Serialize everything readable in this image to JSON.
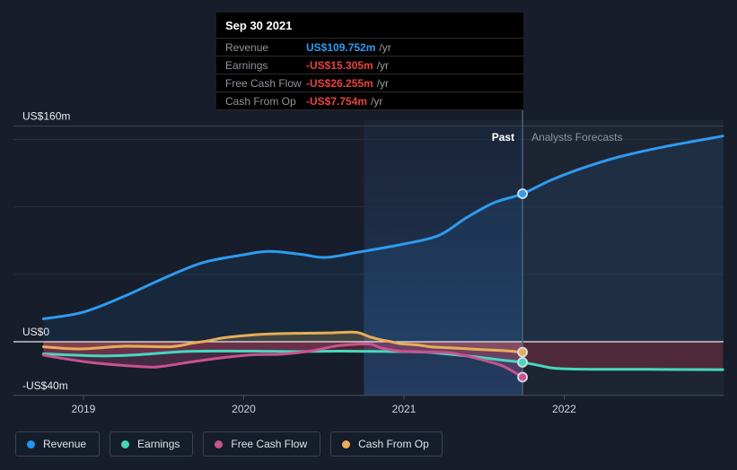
{
  "tooltip": {
    "date": "Sep 30 2021",
    "rows": [
      {
        "label": "Revenue",
        "value": "US$109.752m",
        "suffix": "/yr",
        "color": "#2E9BF0"
      },
      {
        "label": "Earnings",
        "value": "-US$15.305m",
        "suffix": "/yr",
        "color": "#E8443C"
      },
      {
        "label": "Free Cash Flow",
        "value": "-US$26.255m",
        "suffix": "/yr",
        "color": "#E8443C"
      },
      {
        "label": "Cash From Op",
        "value": "-US$7.754m",
        "suffix": "/yr",
        "color": "#E8443C"
      }
    ]
  },
  "labels": {
    "past": "Past",
    "forecast": "Analysts Forecasts"
  },
  "legend": [
    {
      "label": "Revenue",
      "color": "#2196F3"
    },
    {
      "label": "Earnings",
      "color": "#45D6B8"
    },
    {
      "label": "Free Cash Flow",
      "color": "#C9528F"
    },
    {
      "label": "Cash From Op",
      "color": "#E6AE57"
    }
  ],
  "chart_data": {
    "type": "line",
    "x_unit": "year",
    "xlim": [
      2018.75,
      2022.99
    ],
    "ylim": [
      -40,
      160
    ],
    "y_axis_labels": [
      {
        "value": 160,
        "label": "US$160m"
      },
      {
        "value": 0,
        "label": "US$0"
      },
      {
        "value": -40,
        "label": "-US$40m"
      }
    ],
    "y_gridlines": [
      150,
      100,
      50
    ],
    "x_ticks": [
      {
        "value": 2019,
        "label": "2019"
      },
      {
        "value": 2020,
        "label": "2020"
      },
      {
        "value": 2021,
        "label": "2021"
      },
      {
        "value": 2022,
        "label": "2022"
      }
    ],
    "divider_x": 2021.74,
    "highlight_band": [
      2020.75,
      2021.74
    ],
    "legend_position": "bottom",
    "grid": true,
    "series": [
      {
        "name": "Revenue",
        "color": "#2E9BF0",
        "fill": "rgba(46,155,240,0.09)",
        "dot_value": 109.752,
        "points": [
          [
            2018.75,
            17
          ],
          [
            2019.0,
            22
          ],
          [
            2019.26,
            34
          ],
          [
            2019.49,
            46.5
          ],
          [
            2019.74,
            58.5
          ],
          [
            2020.0,
            64.5
          ],
          [
            2020.16,
            67
          ],
          [
            2020.36,
            64.8
          ],
          [
            2020.51,
            62.5
          ],
          [
            2020.72,
            66.5
          ],
          [
            2021.0,
            72.5
          ],
          [
            2021.22,
            79
          ],
          [
            2021.39,
            92
          ],
          [
            2021.56,
            103
          ],
          [
            2021.74,
            109.752
          ],
          [
            2021.92,
            120
          ],
          [
            2022.12,
            129
          ],
          [
            2022.34,
            137
          ],
          [
            2022.62,
            144.5
          ],
          [
            2022.99,
            152.5
          ]
        ]
      },
      {
        "name": "Cash From Op",
        "color": "#E6AE57",
        "fill": "rgba(230,174,87,0.20)",
        "dot_value": -7.754,
        "points": [
          [
            2018.75,
            -3.7
          ],
          [
            2018.98,
            -5.3
          ],
          [
            2019.26,
            -3.3
          ],
          [
            2019.54,
            -3.7
          ],
          [
            2019.68,
            -1
          ],
          [
            2019.77,
            0.5
          ],
          [
            2019.88,
            3
          ],
          [
            2020.05,
            5
          ],
          [
            2020.22,
            6
          ],
          [
            2020.38,
            6.3
          ],
          [
            2020.55,
            6.6
          ],
          [
            2020.7,
            7
          ],
          [
            2020.79,
            3.5
          ],
          [
            2020.86,
            1.3
          ],
          [
            2020.92,
            0
          ],
          [
            2020.98,
            -1.5
          ],
          [
            2021.08,
            -2.3
          ],
          [
            2021.17,
            -3.8
          ],
          [
            2021.28,
            -4.5
          ],
          [
            2021.39,
            -5.2
          ],
          [
            2021.5,
            -5.9
          ],
          [
            2021.62,
            -6.6
          ],
          [
            2021.74,
            -7.754
          ]
        ]
      },
      {
        "name": "Earnings",
        "color": "#46D8BE",
        "fill": "rgba(222,62,72,0.26)",
        "dot_value": -15.305,
        "points": [
          [
            2018.75,
            -9
          ],
          [
            2019.1,
            -10.5
          ],
          [
            2019.32,
            -9.8
          ],
          [
            2019.66,
            -7.2
          ],
          [
            2020.05,
            -7
          ],
          [
            2020.33,
            -7.3
          ],
          [
            2020.58,
            -7
          ],
          [
            2021.08,
            -7.5
          ],
          [
            2021.26,
            -9
          ],
          [
            2021.39,
            -10.5
          ],
          [
            2021.5,
            -12
          ],
          [
            2021.62,
            -13.7
          ],
          [
            2021.74,
            -15.305
          ],
          [
            2021.84,
            -17.5
          ],
          [
            2021.95,
            -19.8
          ],
          [
            2022.18,
            -20.4
          ],
          [
            2022.5,
            -20.5
          ],
          [
            2022.99,
            -20.7
          ]
        ]
      },
      {
        "name": "Free Cash Flow",
        "color": "#C9528F",
        "fill": "rgba(201,82,143,0.25)",
        "dot_value": -26.255,
        "points": [
          [
            2018.75,
            -10
          ],
          [
            2019.04,
            -15.3
          ],
          [
            2019.38,
            -18.6
          ],
          [
            2019.49,
            -18.3
          ],
          [
            2019.67,
            -15
          ],
          [
            2019.86,
            -12
          ],
          [
            2020.05,
            -9.7
          ],
          [
            2020.23,
            -9.3
          ],
          [
            2020.41,
            -7
          ],
          [
            2020.58,
            -3.1
          ],
          [
            2020.69,
            -2
          ],
          [
            2020.79,
            -1.8
          ],
          [
            2020.86,
            -4.7
          ],
          [
            2020.97,
            -6.9
          ],
          [
            2021.08,
            -7.5
          ],
          [
            2021.28,
            -8.2
          ],
          [
            2021.39,
            -10.5
          ],
          [
            2021.5,
            -13.8
          ],
          [
            2021.62,
            -18.2
          ],
          [
            2021.74,
            -26.255
          ]
        ]
      }
    ]
  }
}
